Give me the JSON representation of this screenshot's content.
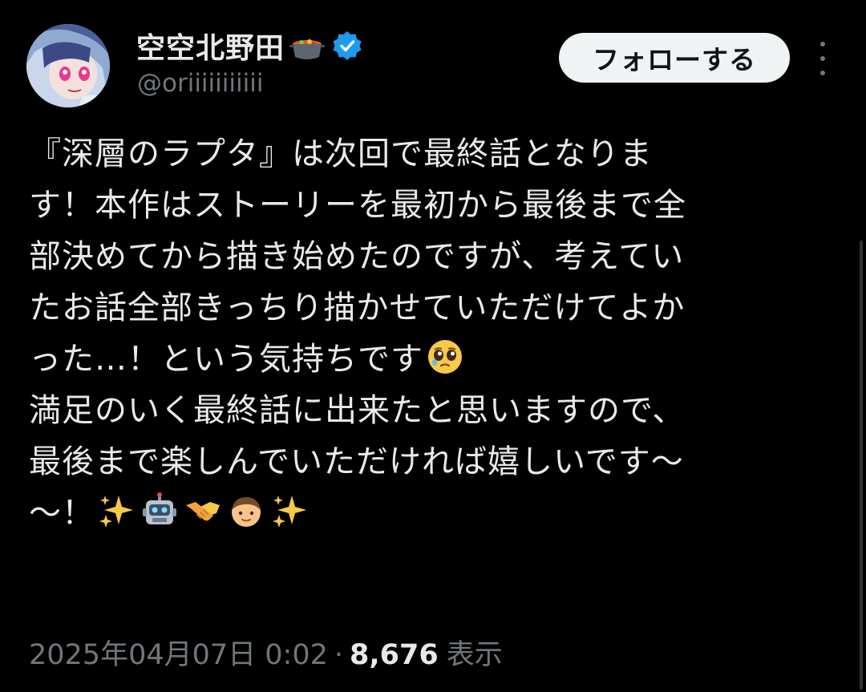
{
  "user": {
    "display_name": "空空北野田",
    "handle": "@oriiiiiiiiiii",
    "avatar_icon": "avatar-image",
    "name_emoji": "stew-pot-icon",
    "verified_icon": "verified-badge-icon",
    "verified_color": "#1d9bf0"
  },
  "actions": {
    "follow_label": "フォローする",
    "more_icon": "more-vertical-icon"
  },
  "tweet": {
    "lines": [
      "『深層のラプタ』は次回で最終話となりま",
      "す！本作はストーリーを最初から最後まで全",
      "部決めてから描き始めたのですが、考えてい",
      "たお話全部きっちり描かせていただけてよか",
      "った…！という気持ちです",
      "満足のいく最終話に出来たと思いますので、",
      "最後まで楽しんでいただければ嬉しいです〜",
      "〜！"
    ],
    "emojis": {
      "line5": [
        "pleading-face-emoji"
      ],
      "line8": [
        "sparkles-emoji",
        "robot-emoji",
        "handshake-emoji",
        "boy-emoji",
        "sparkles-emoji"
      ]
    }
  },
  "meta": {
    "datetime": "2025年04月07日 0:02",
    "separator": "·",
    "view_count": "8,676",
    "views_label": "表示"
  },
  "colors": {
    "background": "#000000",
    "text": "#e7e9ea",
    "secondary": "#71767b",
    "button_bg": "#eff3f4",
    "button_text": "#0f1419"
  }
}
